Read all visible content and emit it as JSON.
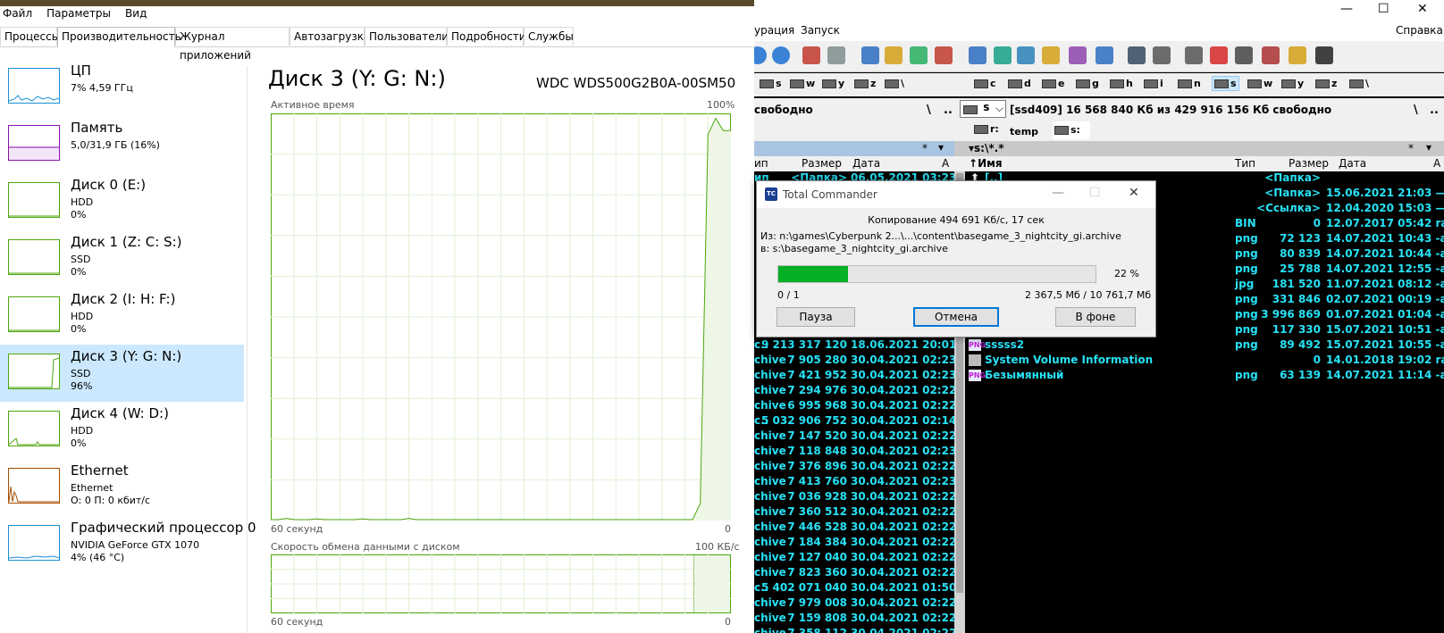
{
  "task_manager": {
    "menu": [
      "Файл",
      "Параметры",
      "Вид"
    ],
    "tabs": [
      "Процессы",
      "Производительность",
      "Журнал приложений",
      "Автозагрузка",
      "Пользователи",
      "Подробности",
      "Службы"
    ],
    "resources": [
      {
        "name": "ЦП",
        "line2": "7% 4,59 ГГц",
        "line3": "",
        "color": "#1b8fd4"
      },
      {
        "name": "Память",
        "line2": "5,0/31,9 ГБ (16%)",
        "line3": "",
        "color": "#8b12ae"
      },
      {
        "name": "Диск 0 (E:)",
        "line2": "HDD",
        "line3": "0%",
        "color": "#4da60c"
      },
      {
        "name": "Диск 1 (Z: C: S:)",
        "line2": "SSD",
        "line3": "0%",
        "color": "#4da60c"
      },
      {
        "name": "Диск 2 (I: H: F:)",
        "line2": "HDD",
        "line3": "0%",
        "color": "#4da60c"
      },
      {
        "name": "Диск 3 (Y: G: N:)",
        "line2": "SSD",
        "line3": "96%",
        "color": "#4da60c"
      },
      {
        "name": "Диск 4 (W: D:)",
        "line2": "HDD",
        "line3": "0%",
        "color": "#4da60c"
      },
      {
        "name": "Ethernet",
        "line2": "Ethernet",
        "line3": "О: 0 П: 0 кбит/с",
        "color": "#a74f01"
      },
      {
        "name": "Графический процессор 0",
        "line2": "NVIDIA GeForce GTX 1070",
        "line3": "4% (46 °C)",
        "color": "#1b8fd4"
      }
    ],
    "selected_index": 5,
    "disk_title": "Диск 3 (Y: G: N:)",
    "disk_model": "WDC WDS500G2B0A-00SM50",
    "active_time_label": "Активное время",
    "active_time_max": "100%",
    "x_label_1": "60 секунд",
    "x_min_1": "0",
    "transfer_label": "Скорость обмена данными с диском",
    "transfer_max": "100 КБ/с",
    "x_label_2": "60 секунд",
    "x_min_2": "0",
    "graph_color": "#4da60c"
  },
  "total_commander": {
    "menu_left": "урация",
    "menu_run": "Запуск",
    "menu_help": "Справка",
    "title_controls": [
      "—",
      "☐",
      "✕"
    ],
    "left_drives": [
      "s",
      "w",
      "y",
      "z",
      "\\"
    ],
    "right_drives": [
      "c",
      "d",
      "e",
      "g",
      "h",
      "i",
      "n",
      "s",
      "w",
      "y",
      "z",
      "\\"
    ],
    "left_free": "свободно",
    "right_drive_select": "s",
    "right_free": "[ssd409]  16 568 840 Кб из 429 916 156 Кб свободно",
    "right_tabs": [
      "r:",
      "temp",
      "s:"
    ],
    "right_path": "s:\\*.*",
    "star": "*",
    "left_cols": [
      "ип",
      "Размер",
      "Дата",
      "А"
    ],
    "right_cols": [
      "Имя",
      "Тип",
      "Размер",
      "Дата",
      "А"
    ],
    "left_rows": [
      [
        "ип",
        "<Папка>",
        "06.05.2021 03:23"
      ],
      [
        "",
        "",
        ""
      ],
      [
        "",
        "",
        ""
      ],
      [
        "",
        "",
        ""
      ],
      [
        "",
        "",
        ""
      ],
      [
        "",
        "",
        ""
      ],
      [
        "",
        "",
        ""
      ],
      [
        "",
        "",
        ""
      ],
      [
        "",
        "",
        ""
      ],
      [
        "",
        "",
        ""
      ],
      [
        "",
        "",
        ""
      ],
      [
        "c..",
        "9 213 317 120",
        "18.06.2021 20:01"
      ],
      [
        "chive",
        "7 905 280",
        "30.04.2021 02:23"
      ],
      [
        "chive",
        "7 421 952",
        "30.04.2021 02:23"
      ],
      [
        "chive",
        "7 294 976",
        "30.04.2021 02:22"
      ],
      [
        "chive",
        "6 995 968",
        "30.04.2021 02:22"
      ],
      [
        "c..",
        "5 032 906 752",
        "30.04.2021 02:14"
      ],
      [
        "chive",
        "7 147 520",
        "30.04.2021 02:22"
      ],
      [
        "chive",
        "7 118 848",
        "30.04.2021 02:23"
      ],
      [
        "chive",
        "7 376 896",
        "30.04.2021 02:22"
      ],
      [
        "chive",
        "7 413 760",
        "30.04.2021 02:23"
      ],
      [
        "chive",
        "7 036 928",
        "30.04.2021 02:22"
      ],
      [
        "chive",
        "7 360 512",
        "30.04.2021 02:22"
      ],
      [
        "chive",
        "7 446 528",
        "30.04.2021 02:22"
      ],
      [
        "chive",
        "7 184 384",
        "30.04.2021 02:22"
      ],
      [
        "chive",
        "7 127 040",
        "30.04.2021 02:22"
      ],
      [
        "chive",
        "7 823 360",
        "30.04.2021 02:22"
      ],
      [
        "c..",
        "5 402 071 040",
        "30.04.2021 01:50"
      ],
      [
        "chive",
        "7 979 008",
        "30.04.2021 02:22"
      ],
      [
        "chive",
        "7 159 808",
        "30.04.2021 02:22"
      ],
      [
        "chive",
        "7 358 112",
        "30.04.2021 02:22"
      ]
    ],
    "right_rows": [
      {
        "name": "[..]",
        "type": "",
        "size": "<Папка>",
        "date": "",
        "icon": "up"
      },
      {
        "name": "",
        "type": "",
        "size": "<Папка>",
        "date": "15.06.2021 21:03 —",
        "icon": ""
      },
      {
        "name": "",
        "type": "",
        "size": "<Ссылка>",
        "date": "12.04.2020 15:03 —",
        "icon": ""
      },
      {
        "name": "",
        "type": "BIN",
        "size": "0",
        "date": "12.07.2017 05:42 rа",
        "icon": ""
      },
      {
        "name": "",
        "type": "png",
        "size": "72 123",
        "date": "14.07.2021 10:43 -а",
        "icon": ""
      },
      {
        "name": "",
        "type": "png",
        "size": "80 839",
        "date": "14.07.2021 10:44 -а",
        "icon": ""
      },
      {
        "name": "",
        "type": "png",
        "size": "25 788",
        "date": "14.07.2021 12:55 -а",
        "icon": ""
      },
      {
        "name": "",
        "type": "jpg",
        "size": "181 520",
        "date": "11.07.2021 08:12 -а",
        "icon": ""
      },
      {
        "name": "",
        "type": "png",
        "size": "331 846",
        "date": "02.07.2021 00:19 -а",
        "icon": ""
      },
      {
        "name": "",
        "type": "png",
        "size": "3 996 869",
        "date": "01.07.2021 01:04 -а",
        "icon": ""
      },
      {
        "name": "",
        "type": "png",
        "size": "117 330",
        "date": "15.07.2021 10:51 -а",
        "icon": ""
      },
      {
        "name": "sssss2",
        "type": "png",
        "size": "89 492",
        "date": "15.07.2021 10:55 -а",
        "icon": "png"
      },
      {
        "name": "System Volume Information",
        "type": "",
        "size": "0",
        "date": "14.01.2018 19:02 rа",
        "icon": "sys"
      },
      {
        "name": "Безымянный",
        "type": "png",
        "size": "63 139",
        "date": "14.07.2021 11:14 -а",
        "icon": "png"
      }
    ]
  },
  "dialog": {
    "title": "Total Commander",
    "speed": "Копирование 494 691 Кб/с, 17 сек",
    "from": "Из:  n:\\games\\Cyberpunk 2...\\...\\content\\basegame_3_nightcity_gi.archive",
    "to": "в:  s:\\basegame_3_nightcity_gi.archive",
    "progress_pct": 22,
    "progress_label": "22 %",
    "count": "0 / 1",
    "sizes": "2 367,5 Мб / 10 761,7 Мб",
    "btn_pause": "Пауза",
    "btn_cancel": "Отмена",
    "btn_bg": "В фоне",
    "controls": [
      "—",
      "☐",
      "✕"
    ],
    "progress_color": "#06b025"
  }
}
